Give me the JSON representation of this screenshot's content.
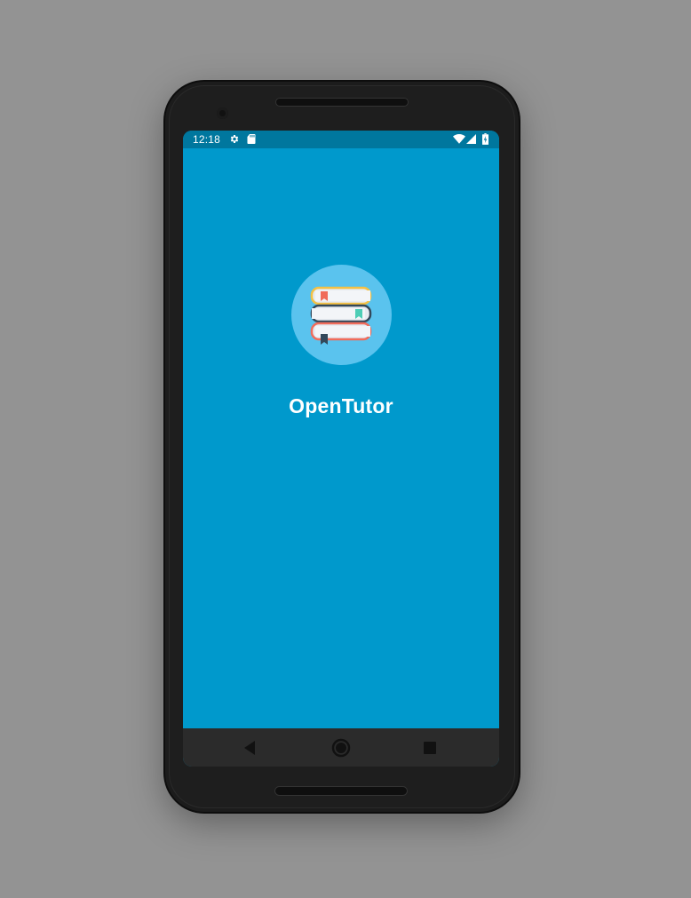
{
  "status_bar": {
    "time": "12:18",
    "left_icons": [
      "settings-icon",
      "sd-card-icon"
    ],
    "right_icons": [
      "wifi-icon",
      "signal-icon",
      "battery-icon"
    ]
  },
  "app": {
    "title": "OpenTutor",
    "logo_icon": "book-stack-icon"
  },
  "nav_bar": {
    "buttons": [
      "back-icon",
      "home-icon",
      "recents-icon"
    ]
  },
  "colors": {
    "background": "#939393",
    "phone_frame": "#1c1c1c",
    "status_bar": "#00779e",
    "app_background": "#0099cc",
    "logo_circle": "#5ac3ee",
    "nav_bar": "#2b2b2b",
    "title_text": "#ffffff"
  }
}
